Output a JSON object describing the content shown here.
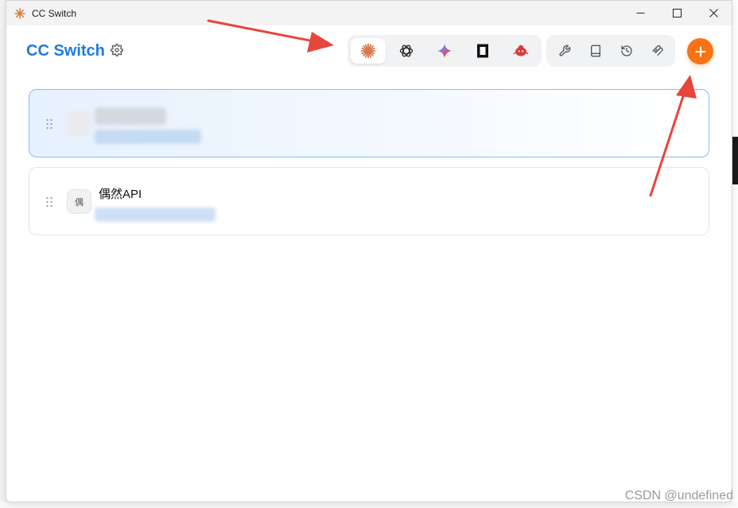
{
  "window": {
    "title": "CC Switch"
  },
  "header": {
    "brand": "CC Switch"
  },
  "app_tabs": [
    {
      "name": "claude",
      "icon": "claude-sparkle-icon",
      "active": true
    },
    {
      "name": "openai",
      "icon": "openai-knot-icon",
      "active": false
    },
    {
      "name": "gemini",
      "icon": "gemini-star-icon",
      "active": false
    },
    {
      "name": "opencode",
      "icon": "square-frame-icon",
      "active": false
    },
    {
      "name": "bug",
      "icon": "red-bug-icon",
      "active": false
    }
  ],
  "tools": [
    {
      "icon": "wrench-icon"
    },
    {
      "icon": "book-icon"
    },
    {
      "icon": "history-icon"
    },
    {
      "icon": "mcp-icon"
    }
  ],
  "providers": [
    {
      "name": "",
      "avatar": "",
      "url": "",
      "selected": true,
      "redacted": true
    },
    {
      "name": "偶然API",
      "avatar": "偶",
      "url": "",
      "selected": false,
      "redacted": true
    }
  ],
  "watermark": "CSDN @undefined",
  "colors": {
    "brand": "#1f7ae0",
    "accent": "#f97316",
    "annotation": "#e8453c"
  }
}
